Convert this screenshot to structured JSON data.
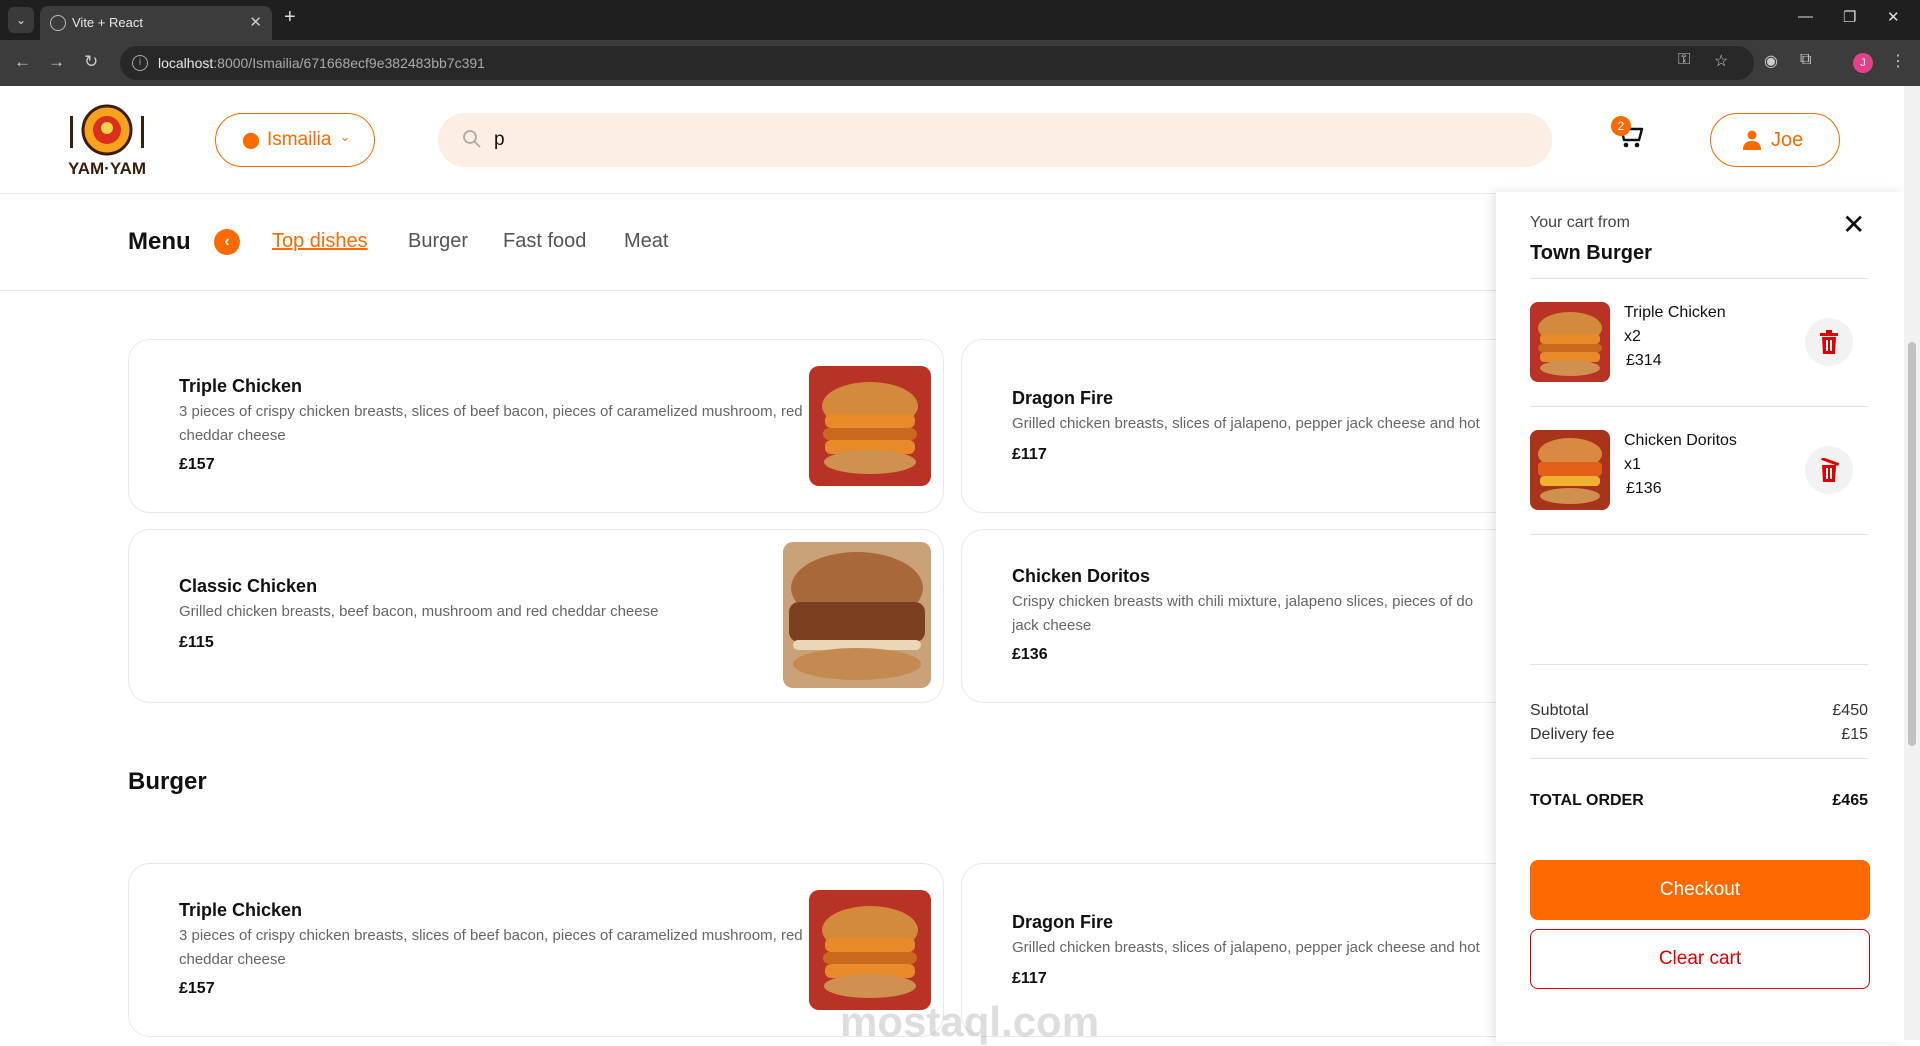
{
  "browser": {
    "tab_title": "Vite + React",
    "url_host": "localhost",
    "url_rest": ":8000/Ismailia/671668ecf9e382483bb7c391",
    "profile_initial": "J"
  },
  "header": {
    "location": "Ismailia",
    "search_value": "p",
    "cart_count": "2",
    "user_name": "Joe"
  },
  "menu": {
    "title": "Menu",
    "tabs": [
      "Top dishes",
      "Burger",
      "Fast food",
      "Meat"
    ]
  },
  "top_dishes": [
    {
      "name": "Triple Chicken",
      "desc": "3 pieces of crispy chicken breasts, slices of beef bacon, pieces of caramelized mushroom, red cheddar cheese",
      "price": "£157"
    },
    {
      "name": "Dragon Fire",
      "desc": "Grilled chicken breasts, slices of jalapeno, pepper jack cheese and hot",
      "price": "£117"
    },
    {
      "name": "Classic Chicken",
      "desc": "Grilled chicken breasts, beef bacon, mushroom and red cheddar cheese",
      "price": "£115"
    },
    {
      "name": "Chicken Doritos",
      "desc": "Crispy chicken breasts with chili mixture, jalapeno slices, pieces of do jack cheese",
      "price": "£136"
    }
  ],
  "burger_section": {
    "title": "Burger",
    "items": [
      {
        "name": "Triple Chicken",
        "desc": "3 pieces of crispy chicken breasts, slices of beef bacon, pieces of caramelized mushroom, red cheddar cheese",
        "price": "£157"
      },
      {
        "name": "Dragon Fire",
        "desc": "Grilled chicken breasts, slices of jalapeno, pepper jack cheese and hot",
        "price": "£117"
      }
    ]
  },
  "cart": {
    "from_label": "Your cart from",
    "restaurant": "Town Burger",
    "items": [
      {
        "name": "Triple Chicken",
        "qty": "x2",
        "price": "£314"
      },
      {
        "name": "Chicken Doritos",
        "qty": "x1",
        "price": "£136"
      }
    ],
    "subtotal_label": "Subtotal",
    "subtotal": "£450",
    "delivery_label": "Delivery fee",
    "delivery": "£15",
    "total_label": "TOTAL ORDER",
    "total": "£465",
    "checkout_label": "Checkout",
    "clear_label": "Clear cart"
  },
  "watermark": "mostaql.com",
  "colors": {
    "accent": "#ff6a00",
    "danger": "#e00000",
    "search_bg": "#fdeee4"
  }
}
